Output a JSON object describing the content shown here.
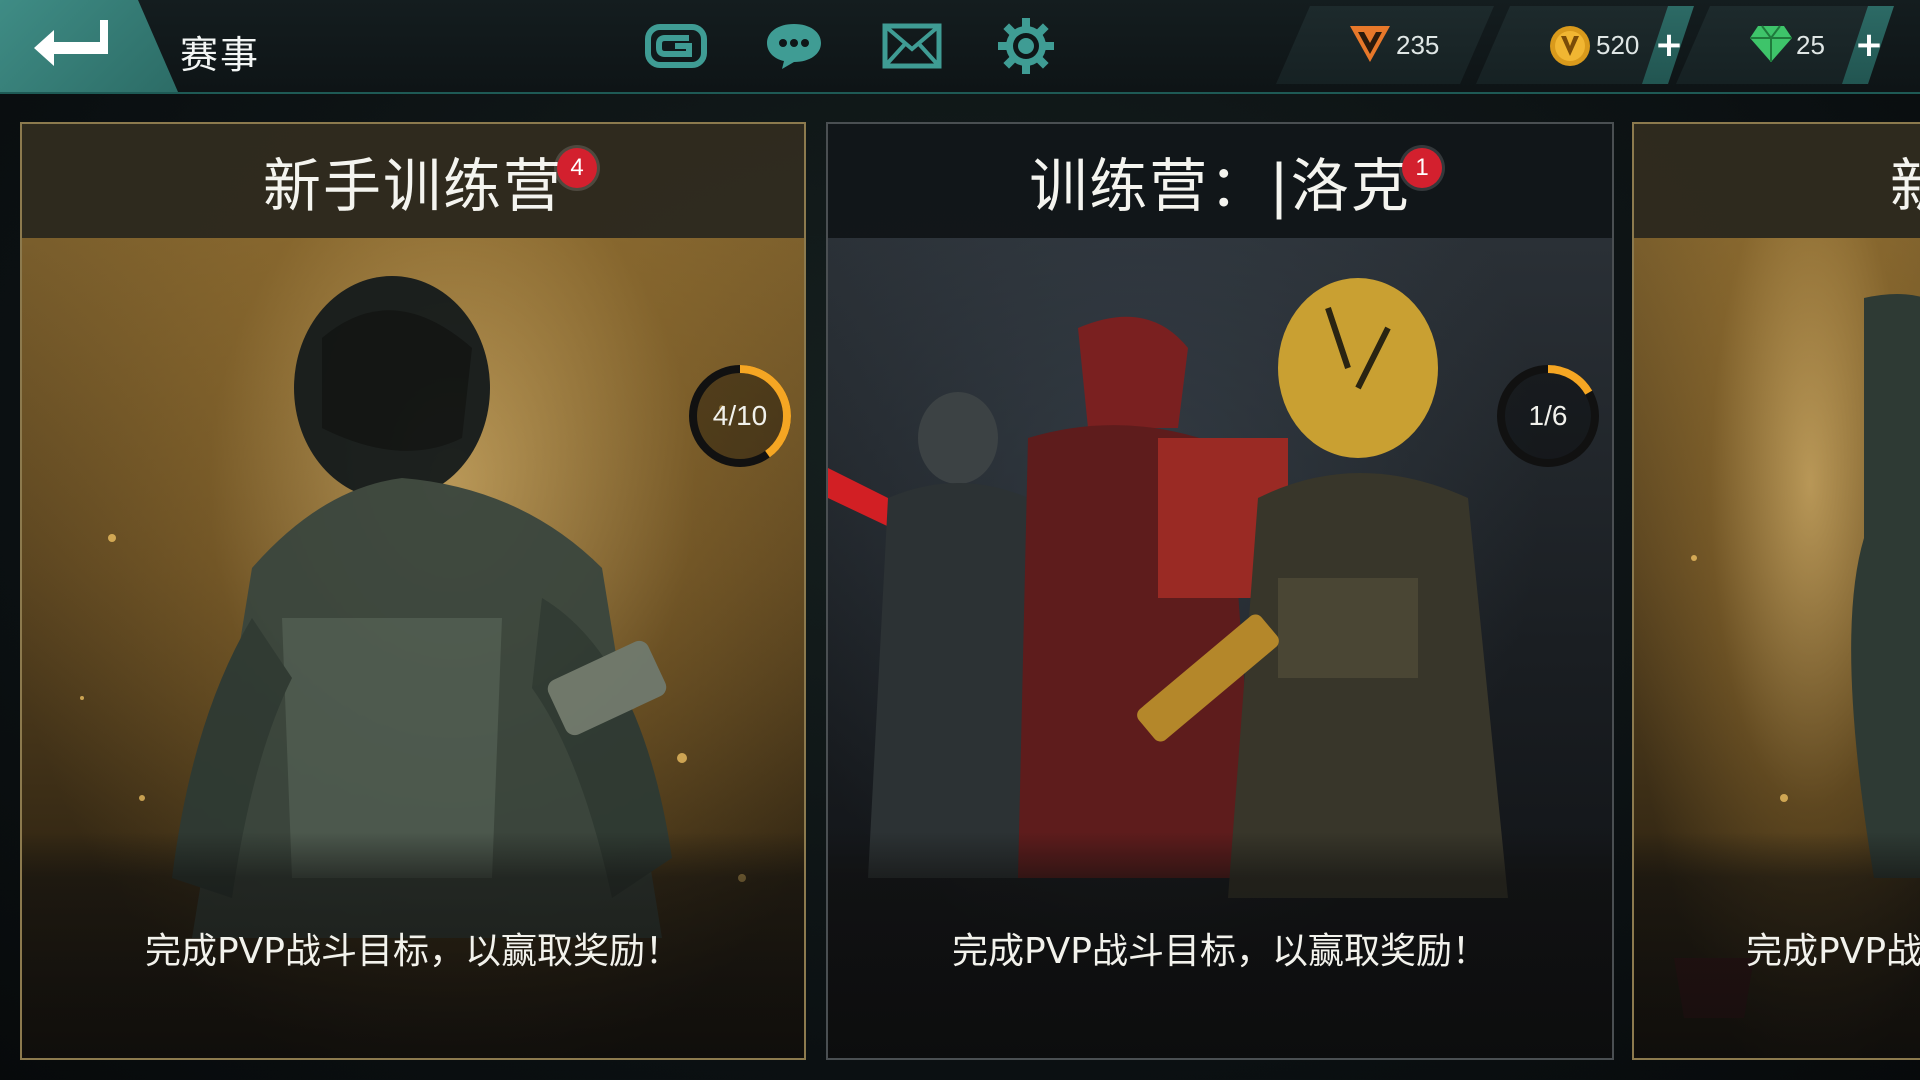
{
  "header": {
    "title": "赛事",
    "icons": [
      "gameloft-icon",
      "chat-icon",
      "mail-icon",
      "settings-icon"
    ]
  },
  "currencies": [
    {
      "name": "v-points",
      "value": "235",
      "icon": "v-badge-icon",
      "has_plus": false
    },
    {
      "name": "credits",
      "value": "520",
      "icon": "gold-coin-icon",
      "has_plus": true
    },
    {
      "name": "gems",
      "value": "25",
      "icon": "diamond-icon",
      "has_plus": true
    }
  ],
  "plus_label": "+",
  "cards": [
    {
      "title": "新手训练营",
      "badge": "4",
      "progress_text": "4/10",
      "progress": 0.4,
      "description": "完成PVP战斗目标，以赢取奖励！"
    },
    {
      "title": "训练营：|洛克",
      "badge": "1",
      "progress_text": "1/6",
      "progress": 0.1667,
      "description": "完成PVP战斗目标，以赢取奖励！"
    },
    {
      "title": "新",
      "badge": "",
      "progress_text": "",
      "description": "完成PVP战"
    }
  ],
  "colors": {
    "accent_teal": "#3f8c85",
    "badge_red": "#d3202e",
    "progress_orange": "#f5a623",
    "ring_dark": "#111111"
  }
}
